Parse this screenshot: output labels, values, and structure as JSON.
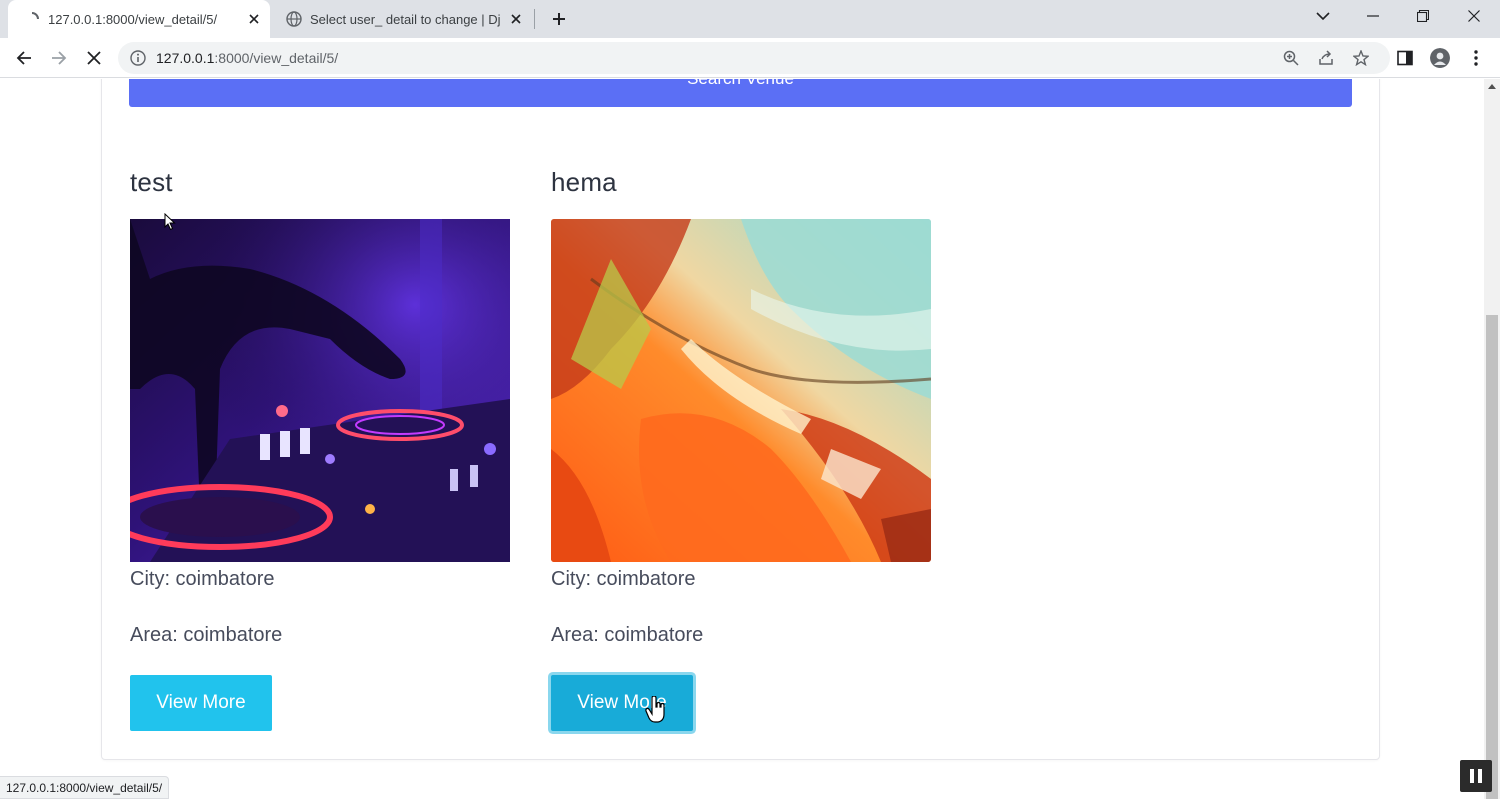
{
  "browser": {
    "tabs": [
      {
        "title": "127.0.0.1:8000/view_detail/5/",
        "active": true,
        "loading": true
      },
      {
        "title": "Select user_ detail to change | Dj",
        "active": false
      }
    ],
    "address": {
      "host": "127.0.0.1",
      "rest": ":8000/view_detail/5/"
    },
    "status_url": "127.0.0.1:8000/view_detail/5/"
  },
  "page": {
    "search_button_label": "Search Venue",
    "venues": [
      {
        "name": "test",
        "city": "City: coimbatore",
        "area": "Area: coimbatore",
        "button_label": "View More",
        "image": "dj-mixer-photo"
      },
      {
        "name": "hema",
        "city": "City: coimbatore",
        "area": "Area: coimbatore",
        "button_label": "View More",
        "image": "abstract-painting"
      }
    ]
  },
  "colors": {
    "search_button": "#5b6ff5",
    "view_more_button": "#21c3ed",
    "view_more_hover": "#18abd8"
  }
}
